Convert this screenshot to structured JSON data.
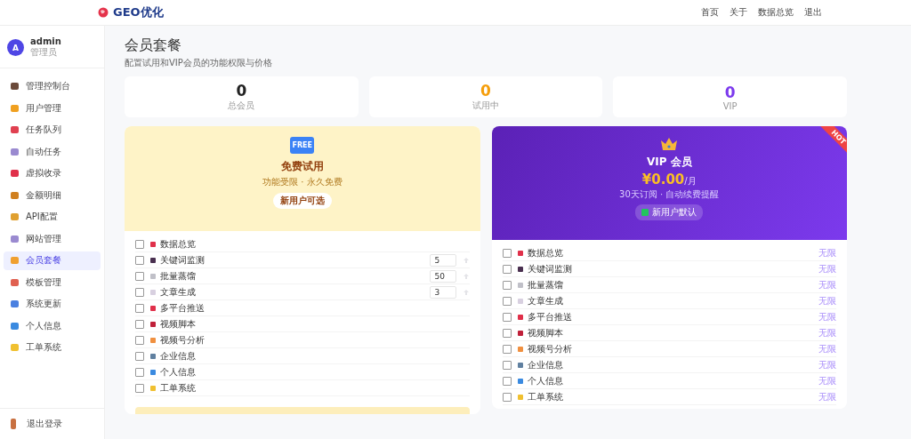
{
  "header": {
    "logo": "GEO优化",
    "nav": [
      {
        "label": "首页"
      },
      {
        "label": "关于"
      },
      {
        "label": "数据总览"
      },
      {
        "label": "退出"
      }
    ]
  },
  "user": {
    "avatar": "A",
    "name": "admin",
    "role": "管理员"
  },
  "sidebar": {
    "items": [
      {
        "label": "管理控制台",
        "selected": false,
        "color": "#6b4a3a"
      },
      {
        "label": "用户管理",
        "selected": false,
        "color": "#f0a020"
      },
      {
        "label": "任务队列",
        "selected": false,
        "color": "#e04050"
      },
      {
        "label": "自动任务",
        "selected": false,
        "color": "#9a8ad0"
      },
      {
        "label": "虚拟收录",
        "selected": false,
        "color": "#e0304a"
      },
      {
        "label": "金额明细",
        "selected": false,
        "color": "#d08020"
      },
      {
        "label": "API配置",
        "selected": false,
        "color": "#e0a030"
      },
      {
        "label": "网站管理",
        "selected": false,
        "color": "#9a8ad0"
      },
      {
        "label": "会员套餐",
        "selected": true,
        "color": "#f0a030"
      },
      {
        "label": "模板管理",
        "selected": false,
        "color": "#e06050"
      },
      {
        "label": "系统更新",
        "selected": false,
        "color": "#4a80e0"
      },
      {
        "label": "个人信息",
        "selected": false,
        "color": "#3a8ae0"
      },
      {
        "label": "工单系统",
        "selected": false,
        "color": "#f0c030"
      }
    ],
    "logout": {
      "label": "退出登录",
      "color": "#c87040"
    }
  },
  "page": {
    "title": "会员套餐",
    "subtitle": "配置试用和VIP会员的功能权限与价格"
  },
  "stats": [
    {
      "value": "0",
      "label": "总会员",
      "color": "#222222"
    },
    {
      "value": "0",
      "label": "试用中",
      "color": "#f59e0b"
    },
    {
      "value": "0",
      "label": "VIP",
      "color": "#7c3aed"
    }
  ],
  "free_plan": {
    "badge": "FREE",
    "title": "免费试用",
    "subtitle": "功能受限 · 永久免费",
    "tag": "新用户可选",
    "features": [
      {
        "label": "数据总览",
        "checked": false,
        "color": "#e0304a"
      },
      {
        "label": "关键词监测",
        "checked": false,
        "color": "#4a3050",
        "quantity": "5"
      },
      {
        "label": "批量蒸馏",
        "checked": false,
        "color": "#c0c0c8",
        "quantity": "50"
      },
      {
        "label": "文章生成",
        "checked": false,
        "color": "#d8d0e0",
        "quantity": "3"
      },
      {
        "label": "多平台推送",
        "checked": false,
        "color": "#e0304a"
      },
      {
        "label": "视频脚本",
        "checked": false,
        "color": "#c0203a"
      },
      {
        "label": "视频号分析",
        "checked": false,
        "color": "#f09040"
      },
      {
        "label": "企业信息",
        "checked": false,
        "color": "#6080a0"
      },
      {
        "label": "个人信息",
        "checked": false,
        "color": "#3a8ae0"
      },
      {
        "label": "工单系统",
        "checked": false,
        "color": "#f0c030"
      }
    ]
  },
  "vip_plan": {
    "ribbon": "HOT",
    "title": "VIP 会员",
    "price": "¥0.00",
    "unit": "/月",
    "subtitle": "30天订阅 · 自动续费提醒",
    "tag": {
      "label": "新用户默认",
      "checked": true
    },
    "features": [
      {
        "label": "数据总览",
        "checked": false,
        "color": "#e0304a",
        "limit": "无限"
      },
      {
        "label": "关键词监测",
        "checked": false,
        "color": "#4a3050",
        "limit": "无限"
      },
      {
        "label": "批量蒸馏",
        "checked": false,
        "color": "#c0c0c8",
        "limit": "无限"
      },
      {
        "label": "文章生成",
        "checked": false,
        "color": "#d8d0e0",
        "limit": "无限"
      },
      {
        "label": "多平台推送",
        "checked": false,
        "color": "#e0304a",
        "limit": "无限"
      },
      {
        "label": "视频脚本",
        "checked": false,
        "color": "#c0203a",
        "limit": "无限"
      },
      {
        "label": "视频号分析",
        "checked": false,
        "color": "#f09040",
        "limit": "无限"
      },
      {
        "label": "企业信息",
        "checked": false,
        "color": "#6080a0",
        "limit": "无限"
      },
      {
        "label": "个人信息",
        "checked": false,
        "color": "#3a8ae0",
        "limit": "无限"
      },
      {
        "label": "工单系统",
        "checked": false,
        "color": "#f0c030",
        "limit": "无限"
      }
    ]
  }
}
